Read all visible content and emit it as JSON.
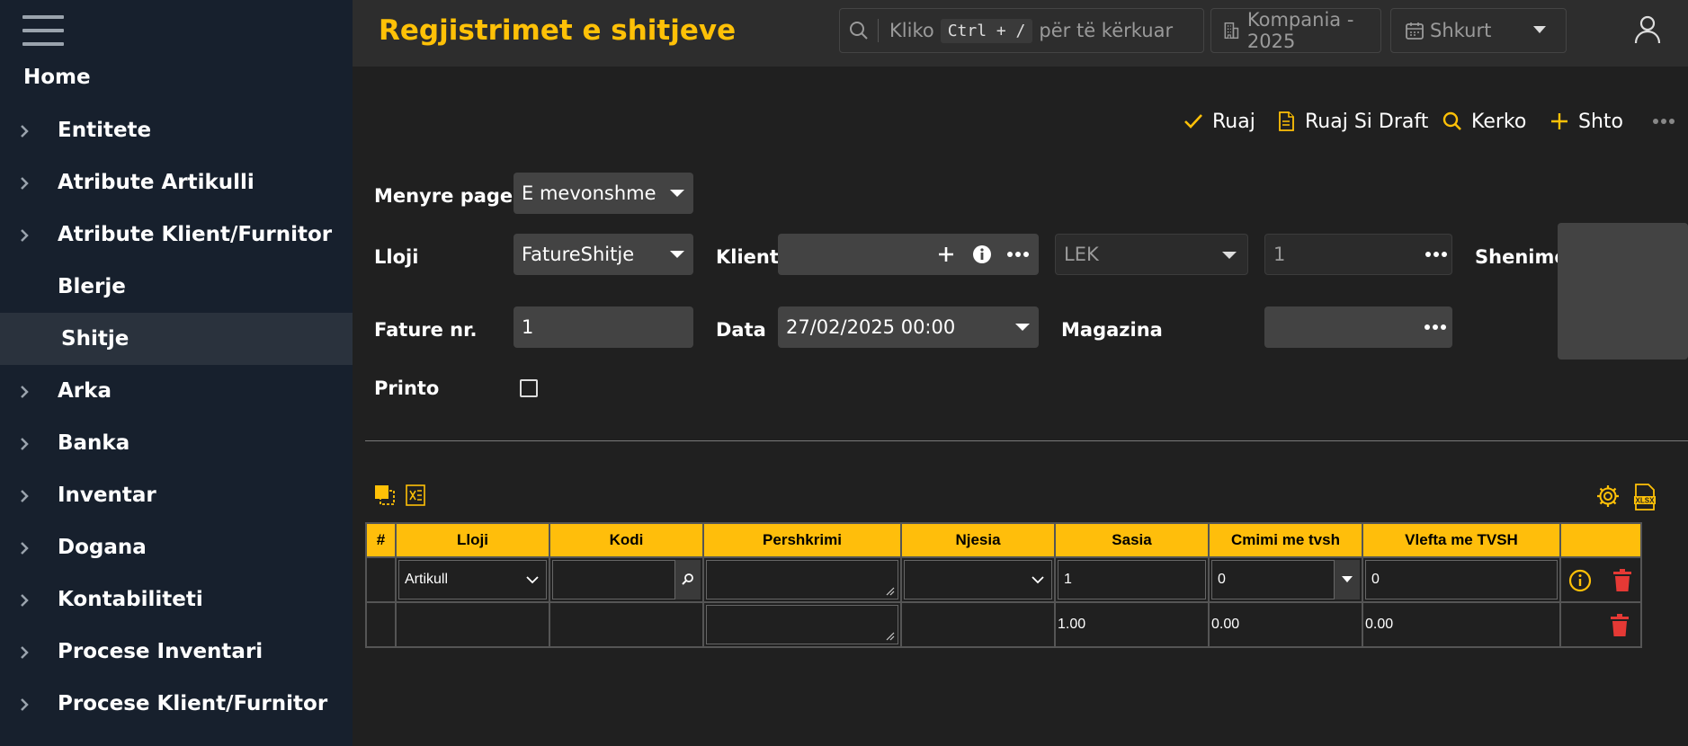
{
  "sidebar": {
    "home": "Home",
    "items": [
      {
        "label": "Entitete"
      },
      {
        "label": "Atribute Artikulli"
      },
      {
        "label": "Atribute Klient/Furnitor"
      },
      {
        "label": "Blerje"
      },
      {
        "label": "Shitje"
      },
      {
        "label": "Arka"
      },
      {
        "label": "Banka"
      },
      {
        "label": "Inventar"
      },
      {
        "label": "Dogana"
      },
      {
        "label": "Kontabiliteti"
      },
      {
        "label": "Procese Inventari"
      },
      {
        "label": "Procese Klient/Furnitor"
      }
    ]
  },
  "header": {
    "title": "Regjistrimet e shitjeve",
    "search_prefix": "Kliko",
    "search_shortcut": "Ctrl + /",
    "search_suffix": "për të kërkuar",
    "company": "Kompania - 2025",
    "period": "Shkurt"
  },
  "toolbar": {
    "save": "Ruaj",
    "save_draft": "Ruaj Si Draft",
    "search": "Kerko",
    "add": "Shto"
  },
  "form": {
    "payment_label": "Menyre pagese",
    "payment_value": "E mevonshme",
    "type_label": "Lloji",
    "type_value": "FatureShitje",
    "client_label": "Klienti",
    "client_value": "",
    "currency_value": "LEK",
    "rate_value": "1",
    "notes_label": "Shenime",
    "invoice_label": "Fature nr.",
    "invoice_value": "1",
    "date_label": "Data",
    "date_value": "27/02/2025 00:00",
    "warehouse_label": "Magazina",
    "warehouse_value": "",
    "print_label": "Printo"
  },
  "table": {
    "headers": [
      "#",
      "Lloji",
      "Kodi",
      "Pershkrimi",
      "Njesia",
      "Sasia",
      "Cmimi me tvsh",
      "Vlefta me TVSH",
      ""
    ],
    "edit_row": {
      "type": "Artikull",
      "code": "",
      "unit": "",
      "qty": "1",
      "price": "0",
      "value": "0"
    },
    "total_row": {
      "qty": "1.00",
      "price": "0.00",
      "value": "0.00"
    }
  },
  "colors": {
    "accent": "#ffc107",
    "danger": "#e53935"
  }
}
